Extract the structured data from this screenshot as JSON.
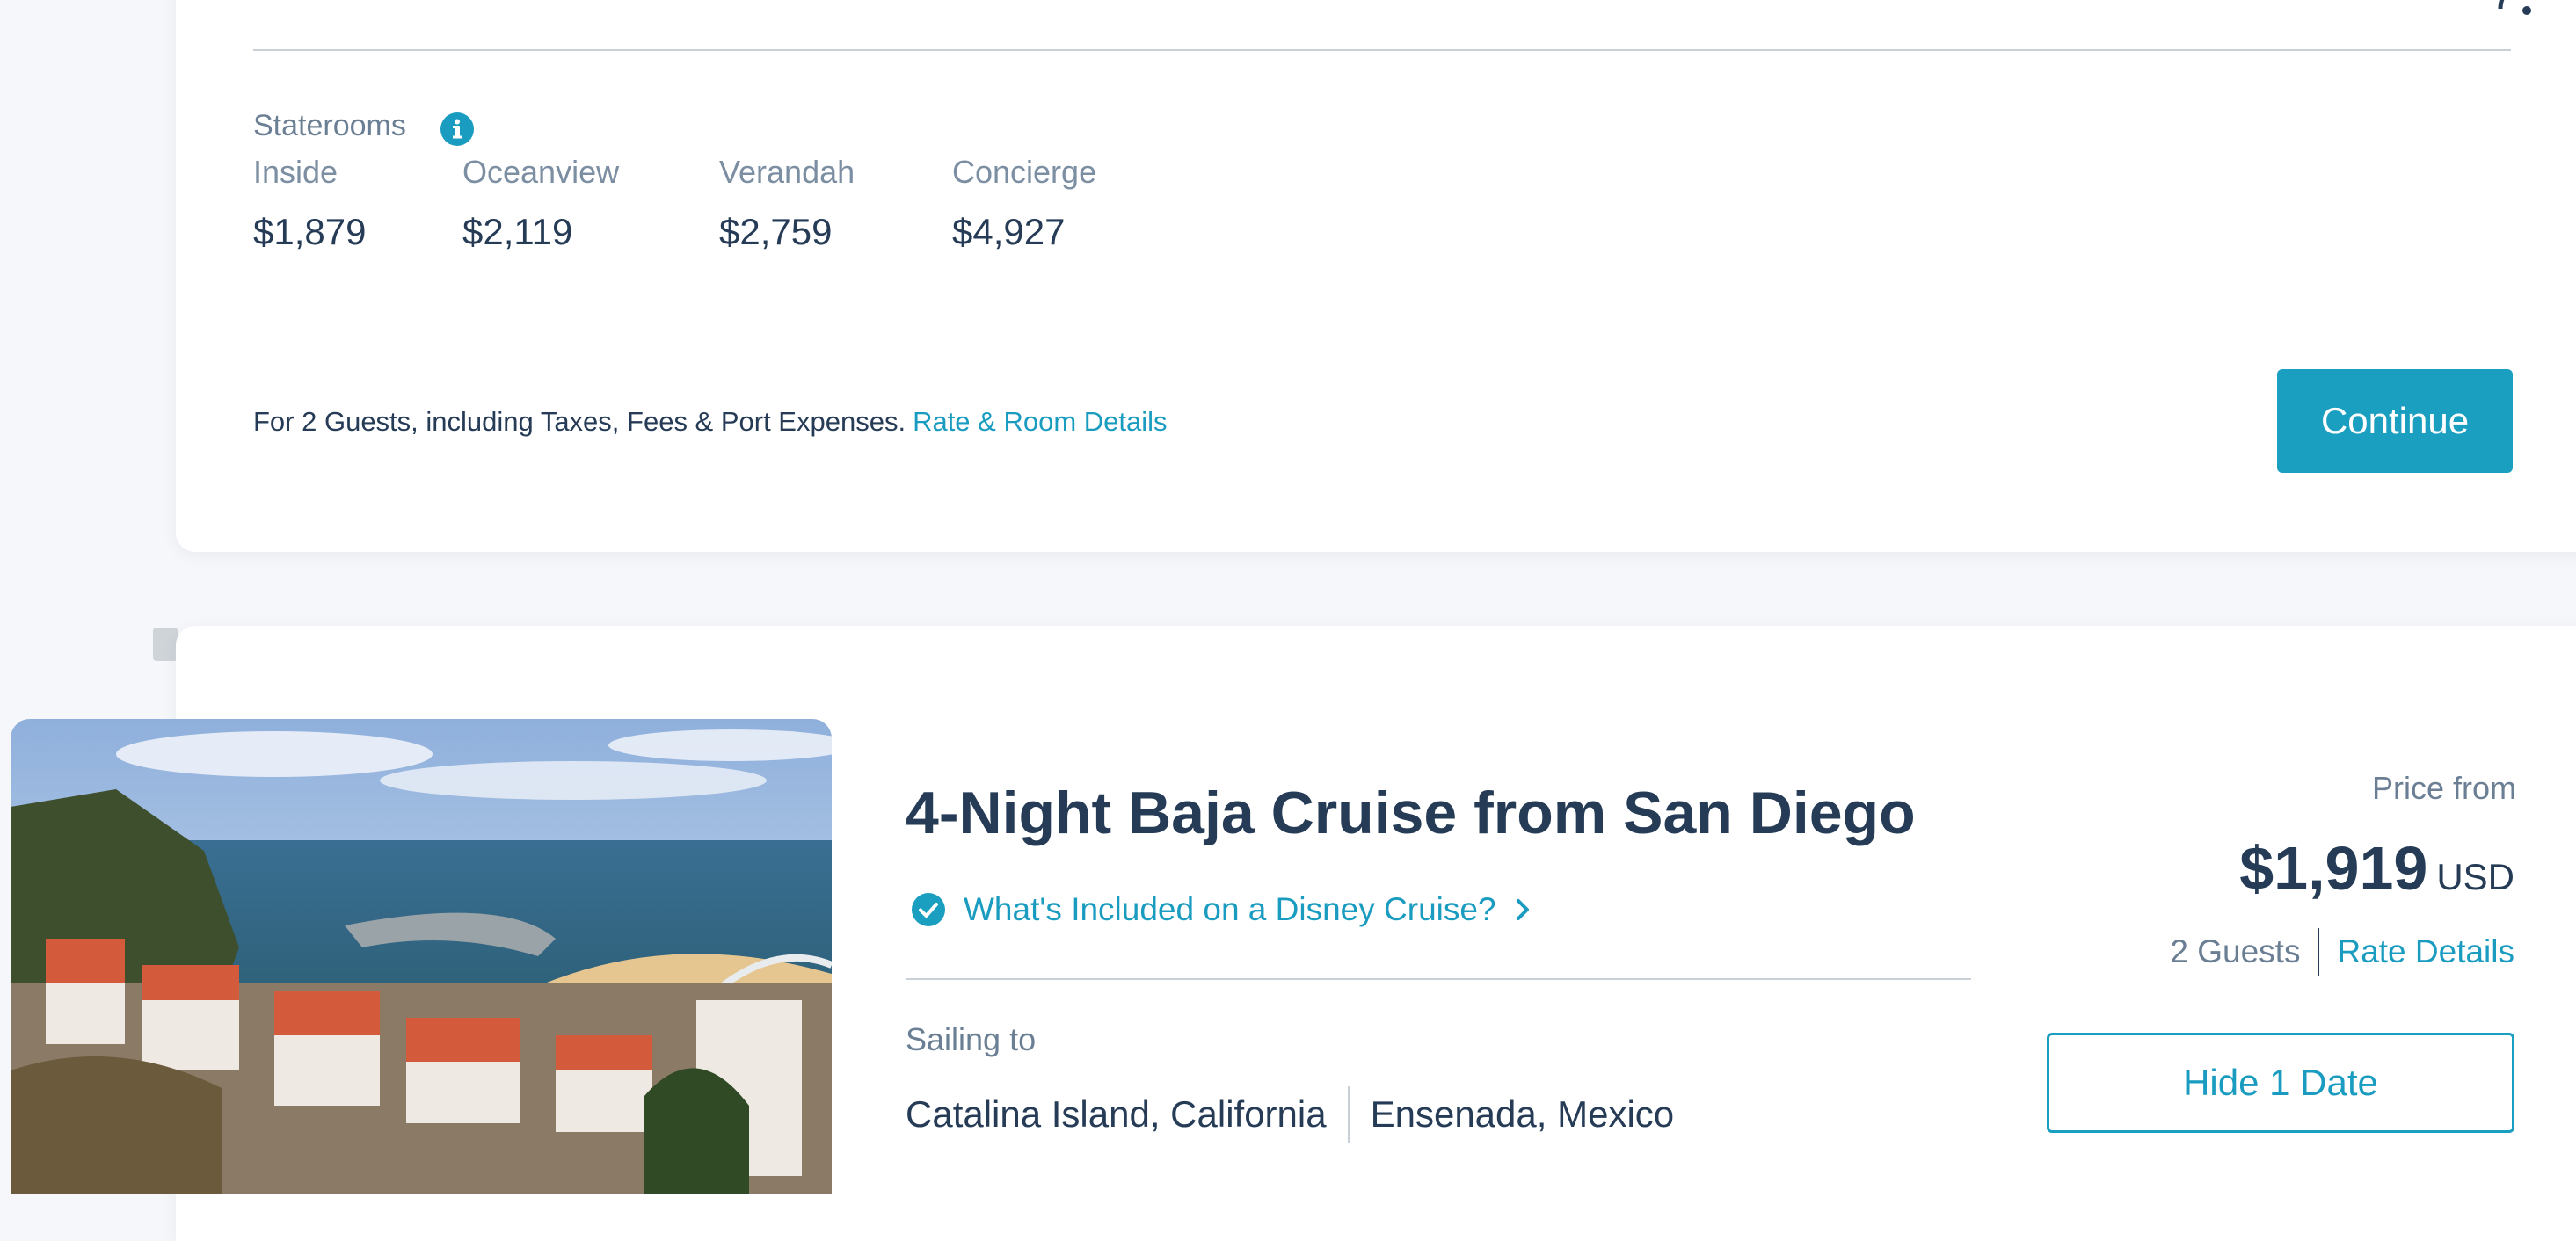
{
  "staterooms_section": {
    "label": "Staterooms",
    "info_icon": "info-icon",
    "rooms": [
      {
        "name": "Inside",
        "price": "$1,879"
      },
      {
        "name": "Oceanview",
        "price": "$2,119"
      },
      {
        "name": "Verandah",
        "price": "$2,759"
      },
      {
        "name": "Concierge",
        "price": "$4,927"
      }
    ],
    "footnote": "For 2 Guests, including Taxes, Fees & Port Expenses.",
    "rate_link": "Rate & Room Details",
    "continue_label": "Continue"
  },
  "cruise": {
    "title": "4-Night Baja Cruise from San Diego",
    "included_link": "What's Included on a Disney Cruise?",
    "included_icon": "check-circle-icon",
    "sailing_label": "Sailing to",
    "ports": [
      "Catalina Island, California",
      "Ensenada, Mexico"
    ],
    "price_from_label": "Price from",
    "price": "$1,919",
    "currency": "USD",
    "guests": "2 Guests",
    "rate_details": "Rate Details",
    "hide_dates_label": "Hide 1 Date"
  },
  "colors": {
    "accent": "#1b9fc1",
    "text_dark": "#253b56",
    "text_muted": "#6b7f94",
    "background": "#f5f7fa"
  }
}
